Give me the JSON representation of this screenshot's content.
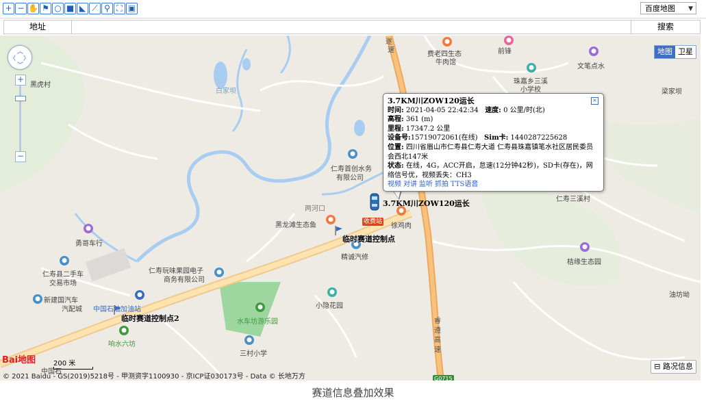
{
  "toolbar": {
    "buttons": [
      {
        "name": "zoom-in-tool",
        "icon": "+"
      },
      {
        "name": "zoom-out-tool",
        "icon": "−"
      },
      {
        "name": "pan-tool",
        "icon": "✋"
      },
      {
        "name": "flag-tool",
        "icon": "⚑"
      },
      {
        "name": "circle-tool",
        "icon": "○"
      },
      {
        "name": "rectangle-tool",
        "icon": "■"
      },
      {
        "name": "polygon-tool",
        "icon": "◣"
      },
      {
        "name": "polyline-tool",
        "icon": "⟋"
      },
      {
        "name": "search-tool",
        "icon": "⚲"
      },
      {
        "name": "fullscreen-tool",
        "icon": "⛶"
      },
      {
        "name": "save-tool",
        "icon": "▣"
      }
    ],
    "map_type_value": "百度地图"
  },
  "address_bar": {
    "label": "地址",
    "search_label": "搜索"
  },
  "map_controls": {
    "zoom_in": "+",
    "zoom_out": "−",
    "type_map": "地图",
    "type_satellite": "卫星"
  },
  "info_window": {
    "title": "3.7KM川ZOW120运长",
    "time_label": "时间:",
    "time_value": "2021-04-05 22:42:34",
    "speed_label": "速度:",
    "speed_value": "0 公里/时(北)",
    "altitude_label": "高程:",
    "altitude_value": "361 (m)",
    "mileage_label": "里程:",
    "mileage_value": "17347.2 公里",
    "device_label": "设备号:",
    "device_value": "15719072061(在线)",
    "sim_label": "Sim卡:",
    "sim_value": "1440287225628",
    "position_label": "位置:",
    "position_value": "四川省眉山市仁寿县仁寿大道 仁寿县珠嘉镇笔水社区居民委员会西北147米",
    "status_label": "状态:",
    "status_value": "在线，4G，ACC开启，怠速(12分钟42秒)，SD卡(存在)，网络信号优，视频丢失：CH3",
    "links": [
      "视频",
      "对讲",
      "监听",
      "抓拍",
      "TTS语音"
    ]
  },
  "vehicle_label": "3.7KM川ZOW120运长",
  "checkpoints": [
    "临时赛道控制点",
    "临时赛道控制点2"
  ],
  "place_labels": [
    "黑虎村",
    "白家坝",
    "费老四生态",
    "牛肉馆",
    "前锋",
    "文笔点水",
    "珠嘉乡三溪",
    "小学校",
    "梁家坝",
    "仁寿首创水务",
    "有限公司",
    "两河口",
    "黑龙滩生态鱼",
    "徐鸡肉",
    "仁寿三溪村",
    "勇哥车行",
    "精诚汽修",
    "桔缘生态园",
    "仁寿县二手车",
    "交易市场",
    "仁寿玩味果园电子",
    "商务有限公司",
    "新建国汽车",
    "汽配城",
    "中国石油加油站",
    "小隐花园",
    "油坊坳",
    "水车坊游乐园",
    "响水六坊",
    "三村小学",
    "中国石",
    "遂",
    "速",
    "睿",
    "遵",
    "高",
    "速"
  ],
  "road_badge": "收费站",
  "highway_badge": "G0715",
  "scale_text": "200 米",
  "copyright": "© 2021 Baidu - GS(2019)5218号 - 甲测资字1100930 - 京ICP证030173号 - Data © 长地万方",
  "baidu_logo": "Bai地图",
  "traffic_button": "路况信息",
  "caption": "赛道信息叠加效果"
}
